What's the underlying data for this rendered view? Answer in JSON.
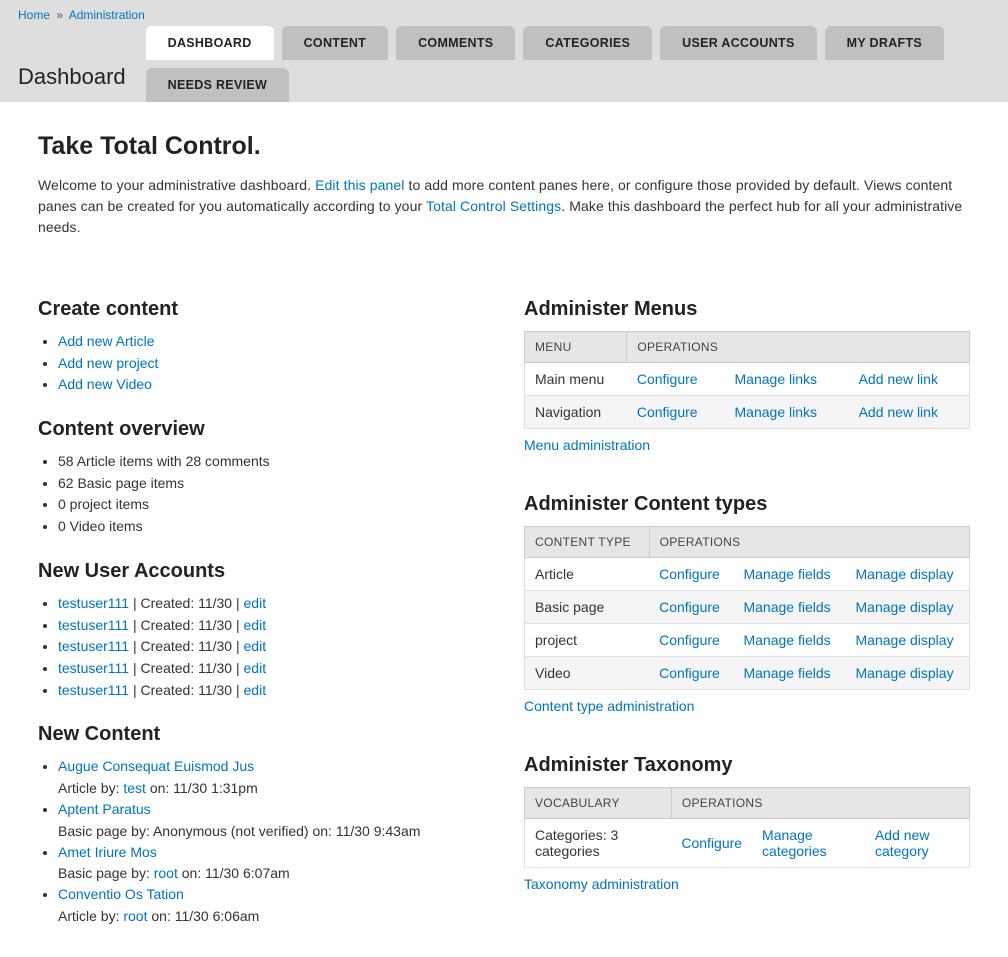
{
  "breadcrumb": {
    "home": "Home",
    "sep": "»",
    "admin": "Administration"
  },
  "page_title": "Dashboard",
  "tabs": [
    "DASHBOARD",
    "CONTENT",
    "COMMENTS",
    "CATEGORIES",
    "USER ACCOUNTS",
    "MY DRAFTS",
    "NEEDS REVIEW"
  ],
  "main_heading": "Take Total Control.",
  "intro": {
    "p1a": "Welcome to your administrative dashboard. ",
    "edit_panel": "Edit this panel",
    "p1b": " to add more content panes here, or configure those provided by default. Views content panes can be created for you automatically according to your ",
    "tcs": "Total Control Settings",
    "p1c": ". Make this dashboard the perfect hub for all your administrative needs."
  },
  "create_content": {
    "heading": "Create content",
    "items": [
      "Add new Article",
      "Add new project",
      "Add new Video"
    ]
  },
  "content_overview": {
    "heading": "Content overview",
    "items": [
      "58 Article items with 28 comments",
      "62 Basic page items",
      "0 project items",
      "0 Video items"
    ]
  },
  "new_users": {
    "heading": "New User Accounts",
    "items": [
      {
        "user": "testuser111",
        "meta": " | Created: 11/30 | ",
        "edit": "edit"
      },
      {
        "user": "testuser111",
        "meta": " | Created: 11/30 | ",
        "edit": "edit"
      },
      {
        "user": "testuser111",
        "meta": " | Created: 11/30 | ",
        "edit": "edit"
      },
      {
        "user": "testuser111",
        "meta": " | Created: 11/30 | ",
        "edit": "edit"
      },
      {
        "user": "testuser111",
        "meta": " | Created: 11/30 | ",
        "edit": "edit"
      }
    ]
  },
  "new_content": {
    "heading": "New Content",
    "items": [
      {
        "title": "Augue Consequat Euismod Jus",
        "sub_pre": "Article by: ",
        "author": "test",
        "sub_post": " on: 11/30 1:31pm"
      },
      {
        "title": "Aptent Paratus",
        "sub_pre": "Basic page by: Anonymous (not verified) on: 11/30 9:43am",
        "author": "",
        "sub_post": ""
      },
      {
        "title": "Amet Iriure Mos",
        "sub_pre": "Basic page by: ",
        "author": "root",
        "sub_post": " on: 11/30 6:07am"
      },
      {
        "title": "Conventio Os Tation",
        "sub_pre": "Article by: ",
        "author": "root",
        "sub_post": " on: 11/30 6:06am"
      }
    ]
  },
  "menus": {
    "heading": "Administer Menus",
    "th": [
      "MENU",
      "OPERATIONS"
    ],
    "rows": [
      {
        "name": "Main menu",
        "ops": [
          "Configure",
          "Manage links",
          "Add new link"
        ]
      },
      {
        "name": "Navigation",
        "ops": [
          "Configure",
          "Manage links",
          "Add new link"
        ]
      }
    ],
    "link": "Menu administration"
  },
  "ctypes": {
    "heading": "Administer Content types",
    "th": [
      "CONTENT TYPE",
      "OPERATIONS"
    ],
    "rows": [
      {
        "name": "Article",
        "ops": [
          "Configure",
          "Manage fields",
          "Manage display"
        ]
      },
      {
        "name": "Basic page",
        "ops": [
          "Configure",
          "Manage fields",
          "Manage display"
        ]
      },
      {
        "name": "project",
        "ops": [
          "Configure",
          "Manage fields",
          "Manage display"
        ]
      },
      {
        "name": "Video",
        "ops": [
          "Configure",
          "Manage fields",
          "Manage display"
        ]
      }
    ],
    "link": "Content type administration"
  },
  "taxonomy": {
    "heading": "Administer Taxonomy",
    "th": [
      "VOCABULARY",
      "OPERATIONS"
    ],
    "rows": [
      {
        "name": "Categories: 3 categories",
        "ops": [
          "Configure",
          "Manage categories",
          "Add new category"
        ]
      }
    ],
    "link": "Taxonomy administration"
  }
}
